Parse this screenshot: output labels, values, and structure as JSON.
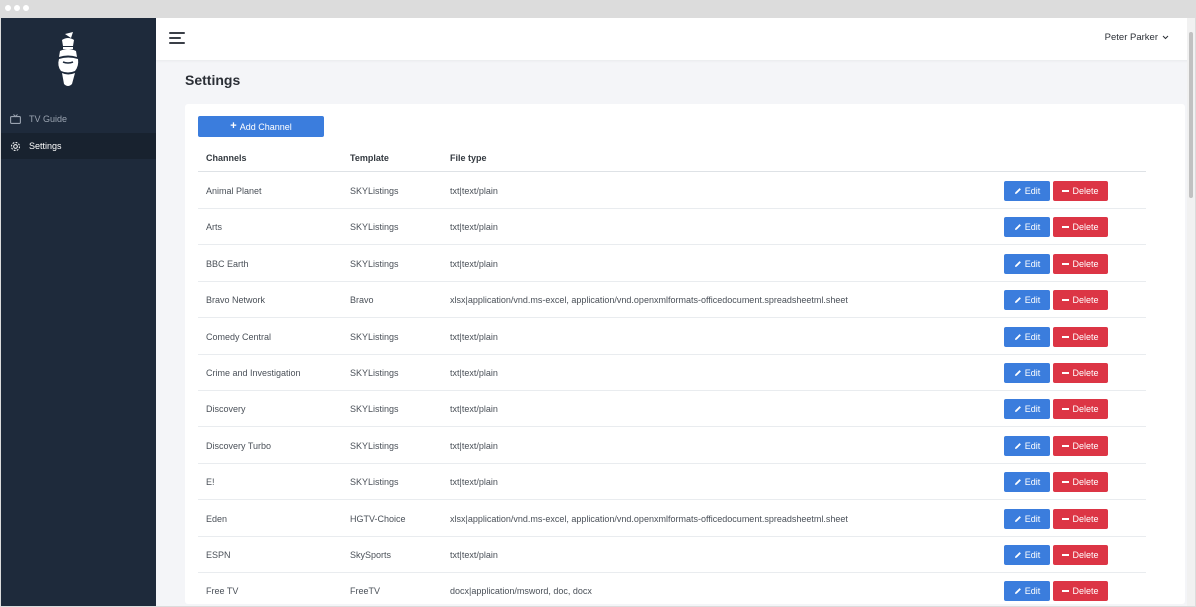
{
  "sidebar": {
    "items": [
      {
        "label": "TV Guide",
        "icon": "tv-icon",
        "active": false
      },
      {
        "label": "Settings",
        "icon": "gear-icon",
        "active": true
      }
    ]
  },
  "header": {
    "user_name": "Peter Parker"
  },
  "page": {
    "title": "Settings"
  },
  "toolbar": {
    "add_channel_label": "Add Channel"
  },
  "table": {
    "columns": [
      "Channels",
      "Template",
      "File type"
    ],
    "edit_label": "Edit",
    "delete_label": "Delete",
    "rows": [
      {
        "channel": "Animal Planet",
        "template": "SKYListings",
        "file_type": "txt|text/plain"
      },
      {
        "channel": "Arts",
        "template": "SKYListings",
        "file_type": "txt|text/plain"
      },
      {
        "channel": "BBC Earth",
        "template": "SKYListings",
        "file_type": "txt|text/plain"
      },
      {
        "channel": "Bravo Network",
        "template": "Bravo",
        "file_type": "xlsx|application/vnd.ms-excel, application/vnd.openxmlformats-officedocument.spreadsheetml.sheet"
      },
      {
        "channel": "Comedy Central",
        "template": "SKYListings",
        "file_type": "txt|text/plain"
      },
      {
        "channel": "Crime and Investigation",
        "template": "SKYListings",
        "file_type": "txt|text/plain"
      },
      {
        "channel": "Discovery",
        "template": "SKYListings",
        "file_type": "txt|text/plain"
      },
      {
        "channel": "Discovery Turbo",
        "template": "SKYListings",
        "file_type": "txt|text/plain"
      },
      {
        "channel": "E!",
        "template": "SKYListings",
        "file_type": "txt|text/plain"
      },
      {
        "channel": "Eden",
        "template": "HGTV-Choice",
        "file_type": "xlsx|application/vnd.ms-excel, application/vnd.openxmlformats-officedocument.spreadsheetml.sheet"
      },
      {
        "channel": "ESPN",
        "template": "SkySports",
        "file_type": "txt|text/plain"
      },
      {
        "channel": "Free TV",
        "template": "FreeTV",
        "file_type": "docx|application/msword, doc, docx"
      }
    ]
  },
  "colors": {
    "sidebar_bg": "#1e2a3b",
    "primary": "#3b7ddd",
    "danger": "#dc3545"
  }
}
